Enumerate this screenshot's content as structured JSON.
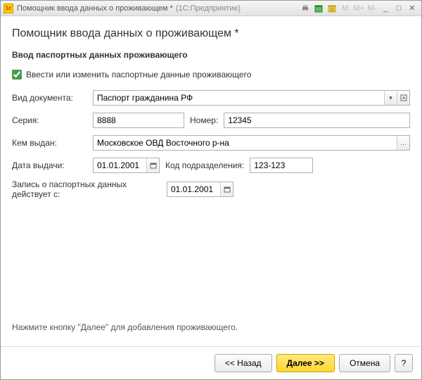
{
  "titlebar": {
    "title": "Помощник ввода данных о проживающем *",
    "app": "(1С:Предприятие)",
    "mbuttons": [
      "M",
      "M+",
      "M-"
    ]
  },
  "page": {
    "heading": "Помощник ввода данных о проживающем *",
    "section": "Ввод паспортных данных проживающего"
  },
  "checkbox": {
    "label": "Ввести или изменить паспортные данные проживающего"
  },
  "labels": {
    "docType": "Вид документа:",
    "series": "Серия:",
    "number": "Номер:",
    "issuedBy": "Кем выдан:",
    "issueDate": "Дата выдачи:",
    "deptCode": "Код подразделения:",
    "validFrom": "Запись о паспортных данных действует с:"
  },
  "values": {
    "docType": "Паспорт гражданина РФ",
    "series": "8888",
    "number": "12345",
    "issuedBy": "Московское ОВД Восточного р-на",
    "issueDate": "01.01.2001",
    "deptCode": "123-123",
    "validFrom": "01.01.2001"
  },
  "hint": "Нажмите кнопку \"Далее\" для добавления проживающего.",
  "footer": {
    "back": "<< Назад",
    "next": "Далее >>",
    "cancel": "Отмена",
    "help": "?"
  }
}
